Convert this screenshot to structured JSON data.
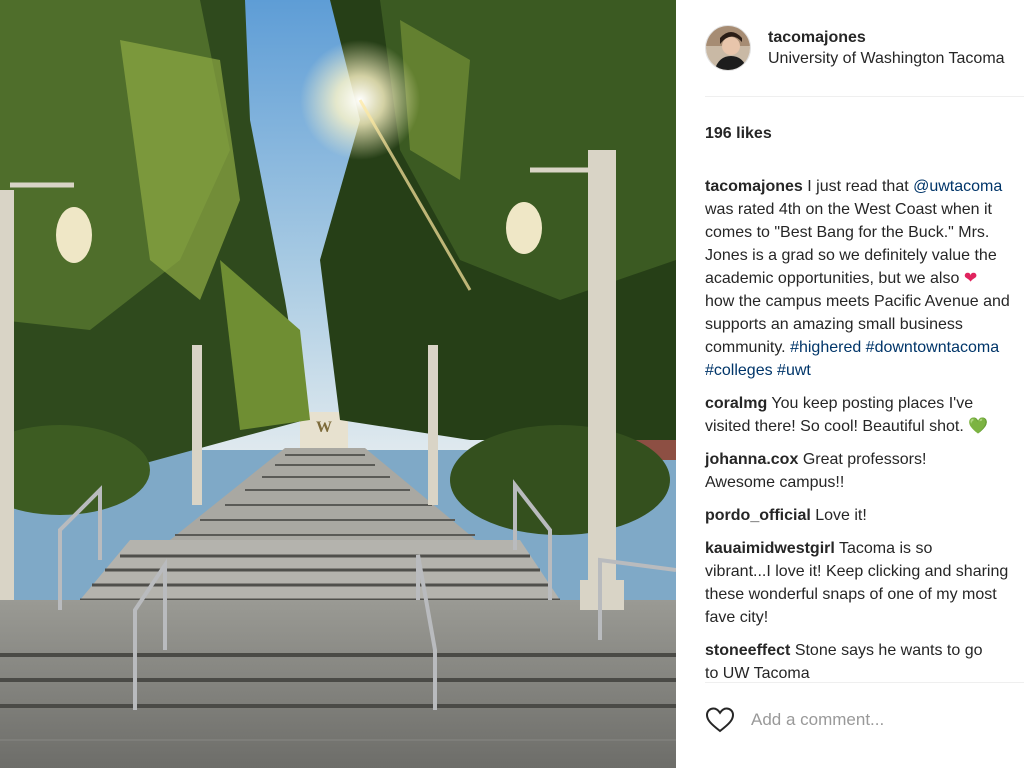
{
  "post": {
    "owner": "tacomajones",
    "location": "University of Washington Tacoma",
    "likes": "196 likes",
    "caption": {
      "user": "tacomajones",
      "lines": [
        [
          "I just read that ",
          "@uwtacoma",
          ""
        ],
        [
          "was rated 4th on the West Coast when it",
          "",
          ""
        ],
        [
          "comes to \"Best Bang for the Buck.\" Mrs.",
          "",
          ""
        ],
        [
          "Jones is a grad so we definitely value the",
          "",
          ""
        ],
        [
          "academic opportunities, but we also ",
          "",
          "❤"
        ],
        [
          "how the campus meets Pacific Avenue and",
          "",
          ""
        ],
        [
          "supports an amazing small business",
          "",
          ""
        ],
        [
          "community. ",
          "#highered #downtowntacoma",
          ""
        ],
        [
          "",
          "#colleges #uwt",
          ""
        ]
      ]
    },
    "comments": [
      {
        "user": "coralmg",
        "lines": [
          "You keep posting places I've",
          "visited there! So cool! Beautiful shot. 💚"
        ]
      },
      {
        "user": "johanna.cox",
        "lines": [
          "Great professors!",
          "Awesome campus!!"
        ]
      },
      {
        "user": "pordo_official",
        "lines": [
          "Love it!"
        ]
      },
      {
        "user": "kauaimidwestgirl",
        "lines": [
          "Tacoma is so",
          "vibrant...I love it! Keep clicking and sharing",
          "these wonderful snaps of one of my most",
          "fave city!"
        ]
      },
      {
        "user": "stoneeffect",
        "lines": [
          "Stone says he wants to go",
          "to UW Tacoma"
        ]
      }
    ],
    "add_comment_placeholder": "Add a comment..."
  },
  "icons": {
    "like": "heart-outline-icon"
  },
  "colors": {
    "link": "#003569",
    "text": "#262626",
    "muted": "#999999"
  }
}
